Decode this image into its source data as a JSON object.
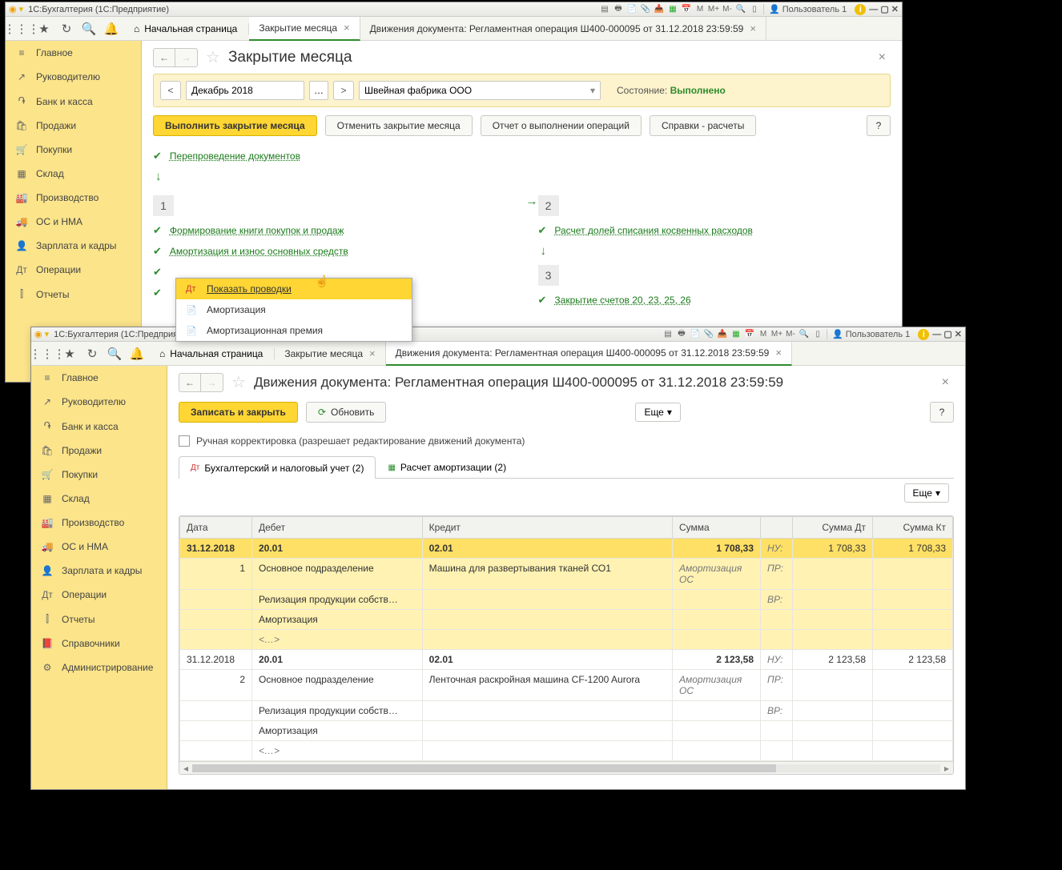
{
  "titlebar": {
    "app_title": "1С:Бухгалтерия  (1С:Предприятие)",
    "user": "Пользователь 1"
  },
  "tabs": {
    "home": "Начальная страница",
    "tab1": "Закрытие месяца",
    "tab2": "Движения документа: Регламентная операция Ш400-000095 от 31.12.2018 23:59:59"
  },
  "sidebar": {
    "items": [
      {
        "icon": "≡",
        "label": "Главное"
      },
      {
        "icon": "↗",
        "label": "Руководителю"
      },
      {
        "icon": "֏",
        "label": "Банк и касса"
      },
      {
        "icon": "🛍",
        "label": "Продажи"
      },
      {
        "icon": "🛒",
        "label": "Покупки"
      },
      {
        "icon": "▦",
        "label": "Склад"
      },
      {
        "icon": "🏭",
        "label": "Производство"
      },
      {
        "icon": "🚚",
        "label": "ОС и НМА"
      },
      {
        "icon": "👤",
        "label": "Зарплата и кадры"
      },
      {
        "icon": "Дт",
        "label": "Операции"
      },
      {
        "icon": "⫿",
        "label": "Отчеты"
      },
      {
        "icon": "📕",
        "label": "Справочники"
      },
      {
        "icon": "⚙",
        "label": "Администрирование"
      }
    ]
  },
  "page1": {
    "title": "Закрытие месяца",
    "period": "Декабрь 2018",
    "org": "Швейная фабрика ООО",
    "state_label": "Состояние:",
    "state_value": "Выполнено",
    "btn_run": "Выполнить закрытие месяца",
    "btn_cancel": "Отменить закрытие месяца",
    "btn_report": "Отчет о выполнении операций",
    "btn_ref": "Справки - расчеты",
    "op_repost": "Перепроведение документов",
    "step1": "1",
    "step2": "2",
    "step3": "3",
    "op_book": "Формирование книги покупок и продаж",
    "op_amort": "Амортизация и износ основных средств",
    "op_share": "Расчет долей списания косвенных расходов",
    "op_close": "Закрытие счетов 20, 23, 25, 26",
    "cm": {
      "show": "Показать проводки",
      "amort": "Амортизация",
      "prem": "Амортизационная премия"
    }
  },
  "page2": {
    "title": "Движения документа: Регламентная операция Ш400-000095 от 31.12.2018 23:59:59",
    "btn_save": "Записать и закрыть",
    "btn_refresh": "Обновить",
    "btn_more": "Еще",
    "manual_label": "Ручная корректировка (разрешает редактирование движений документа)",
    "tab_accounting": "Бухгалтерский и налоговый учет (2)",
    "tab_amort": "Расчет амортизации (2)",
    "cols": {
      "date": "Дата",
      "debit": "Дебет",
      "credit": "Кредит",
      "sum": "Сумма",
      "sum_dt": "Сумма Дт",
      "sum_kt": "Сумма Кт"
    },
    "rows": [
      {
        "date": "31.12.2018",
        "num": "1",
        "debit_acc": "20.01",
        "credit_acc": "02.01",
        "sum": "1 708,33",
        "nu": "НУ:",
        "sum_dt": "1 708,33",
        "sum_kt": "1 708,33",
        "debit_sub1": "Основное подразделение",
        "credit_sub1": "Машина для развертывания тканей СО1",
        "amort": "Амортизация ОС",
        "pr": "ПР:",
        "debit_sub2": "Релизация продукции собств…",
        "vr": "ВР:",
        "debit_sub3": "Амортизация",
        "more": "<…>"
      },
      {
        "date": "31.12.2018",
        "num": "2",
        "debit_acc": "20.01",
        "credit_acc": "02.01",
        "sum": "2 123,58",
        "nu": "НУ:",
        "sum_dt": "2 123,58",
        "sum_kt": "2 123,58",
        "debit_sub1": "Основное подразделение",
        "credit_sub1": "Ленточная раскройная машина CF-1200 Aurora",
        "amort": "Амортизация ОС",
        "pr": "ПР:",
        "debit_sub2": "Релизация продукции собств…",
        "vr": "ВР:",
        "debit_sub3": "Амортизация",
        "more": "<…>"
      }
    ]
  }
}
